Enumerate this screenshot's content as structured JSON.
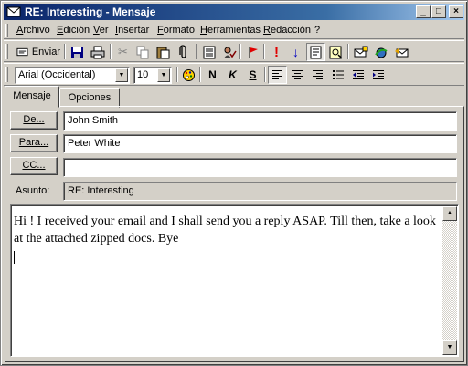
{
  "window": {
    "title": "RE: Interesting - Mensaje",
    "min_glyph": "_",
    "max_glyph": "□",
    "close_glyph": "×"
  },
  "menu": [
    "Archivo",
    "Edición",
    "Ver",
    "Insertar",
    "Formato",
    "Herramientas",
    "Redacción",
    "?"
  ],
  "toolbar": {
    "send_label": "Enviar",
    "buttons": [
      "save-icon",
      "print-icon",
      "cut-icon",
      "copy-icon",
      "paste-icon",
      "attach-icon",
      "address-book-icon",
      "check-names-icon",
      "flag-icon",
      "high-importance-icon",
      "low-importance-icon",
      "options-icon",
      "insert-file-icon",
      "new-message-icon",
      "send-receive-icon",
      "reply-icon"
    ]
  },
  "format": {
    "font": "Arial (Occidental)",
    "size": "10",
    "bold": "N",
    "italic": "K",
    "underline": "S"
  },
  "tabs": [
    "Mensaje",
    "Opciones"
  ],
  "fields": {
    "from_label": "De...",
    "from": "John Smith",
    "to_label": "Para...",
    "to": "Peter White",
    "cc_label": "CC...",
    "cc": "",
    "subject_label": "Asunto:",
    "subject": "RE: Interesting"
  },
  "body": "Hi ! I received your email and I shall send you a reply ASAP. Till then, take a look at the attached zipped docs. Bye",
  "colors": {
    "title_start": "#0a246a",
    "title_end": "#a6caf0",
    "face": "#d4d0c8"
  }
}
